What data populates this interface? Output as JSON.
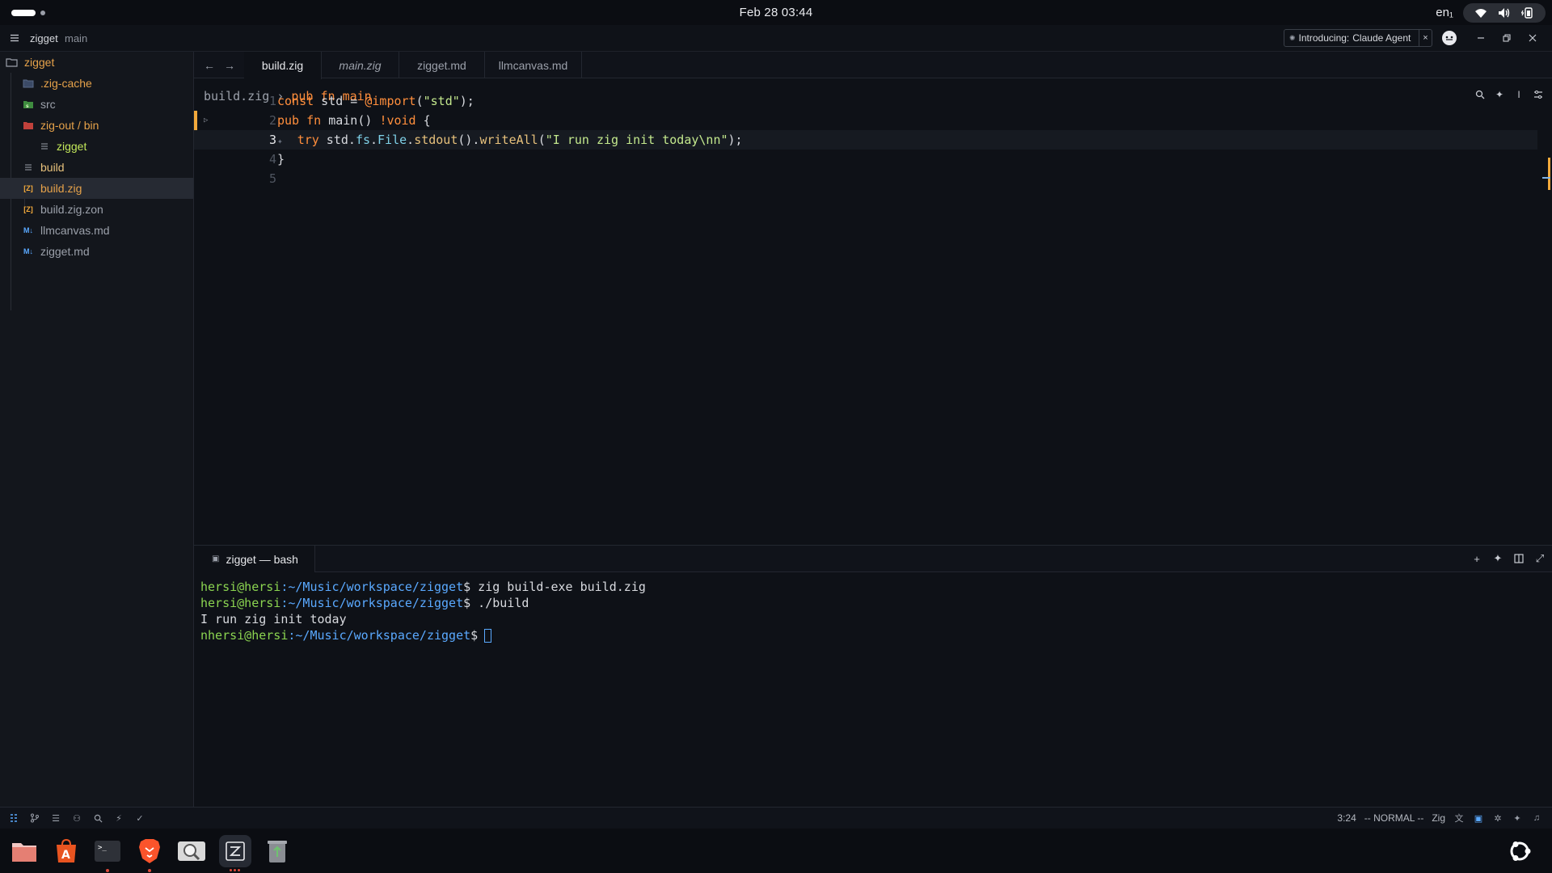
{
  "system": {
    "clock": "Feb 28  03:44",
    "lang": "en₁"
  },
  "titlebar": {
    "project": "zigget",
    "branch": "main",
    "notice_prefix": "Introducing:",
    "notice_text": "Claude Agent",
    "notice_close": "×"
  },
  "sidebar": {
    "root": "zigget",
    "items": [
      {
        "label": ".zig-cache",
        "icon": "folder-icon",
        "color": "#e6a24a"
      },
      {
        "label": "src",
        "icon": "folder-src-icon",
        "color": "#9ba0aa"
      },
      {
        "label": "zig-out / bin",
        "icon": "folder-open-icon",
        "color": "#e6a24a"
      },
      {
        "label": "zigget",
        "icon": "file-icon",
        "color": "#c3e85a"
      },
      {
        "label": "build",
        "icon": "file-icon",
        "color": "#e6c07b"
      },
      {
        "label": "build.zig",
        "icon": "zig-icon",
        "color": "#e6a24a"
      },
      {
        "label": "build.zig.zon",
        "icon": "zig-icon",
        "color": "#9ba0aa"
      },
      {
        "label": "llmcanvas.md",
        "icon": "markdown-icon",
        "color": "#9ba0aa"
      },
      {
        "label": "zigget.md",
        "icon": "markdown-icon",
        "color": "#9ba0aa"
      }
    ]
  },
  "editor": {
    "tabs": [
      {
        "label": "build.zig",
        "active": true
      },
      {
        "label": "main.zig",
        "italic": true
      },
      {
        "label": "zigget.md"
      },
      {
        "label": "llmcanvas.md"
      }
    ],
    "breadcrumb_file": "build.zig",
    "breadcrumb_sep": "›",
    "breadcrumb_symbol": "pub fn main",
    "current_line": 3,
    "lines": [
      {
        "num": "1"
      },
      {
        "num": "2"
      },
      {
        "num": "3"
      },
      {
        "num": "4"
      },
      {
        "num": "5"
      }
    ],
    "code": {
      "l1_const": "const",
      "l1_rest": " std = ",
      "l1_builtin": "@import",
      "l1_open": "(",
      "l1_str": "\"std\"",
      "l1_close": ");",
      "l2_pub": "pub",
      "l2_fn": " fn",
      "l2_rest": " main() ",
      "l2_void": "!void",
      "l2_brace": " {",
      "l3_try": "try",
      "l3_std": " std",
      "l3_dot1": ".",
      "l3_fs": "fs",
      "l3_dot2": ".",
      "l3_file": "File",
      "l3_dot3": ".",
      "l3_stdout": "stdout",
      "l3_mid": "().",
      "l3_write": "writeAll",
      "l3_open": "(",
      "l3_str": "\"I run zig init today\\nn\"",
      "l3_close": ");",
      "l4_brace": "}"
    }
  },
  "terminal": {
    "tab_label": "zigget — bash",
    "lines": [
      {
        "user": "hersi@hersi",
        "path": ":~/Music/workspace/zigget",
        "prompt": "$",
        "cmd": " zig build-exe build.zig"
      },
      {
        "user": "hersi@hersi",
        "path": ":~/Music/workspace/zigget",
        "prompt": "$",
        "cmd": " ./build"
      },
      {
        "output": "I run zig init today"
      },
      {
        "user": "nhersi@hersi",
        "path": ":~/Music/workspace/zigget",
        "prompt": "$",
        "cmd": ""
      }
    ]
  },
  "statusbar": {
    "position": "3:24",
    "mode": "-- NORMAL --",
    "language": "Zig"
  }
}
